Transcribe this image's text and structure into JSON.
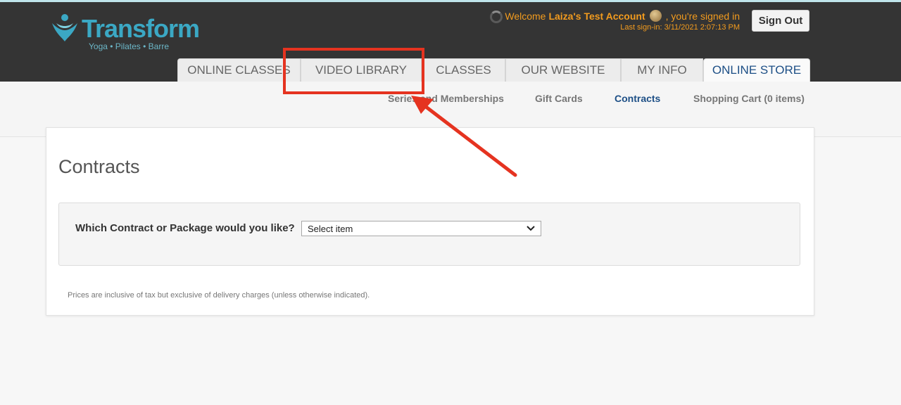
{
  "header": {
    "logo_text": "Transform",
    "logo_tagline": "Yoga • Pilates • Barre",
    "welcome_prefix": "Welcome",
    "account_name": "Laiza's Test Account",
    "welcome_suffix": ", you're signed in",
    "last_signin": "Last sign-in: 3/11/2021 2:07:13 PM",
    "signout_label": "Sign Out"
  },
  "tabs": [
    {
      "label": "ONLINE CLASSES",
      "active": false
    },
    {
      "label": "VIDEO LIBRARY",
      "active": false
    },
    {
      "label": "CLASSES",
      "active": false
    },
    {
      "label": "OUR WEBSITE",
      "active": false
    },
    {
      "label": "MY INFO",
      "active": false
    },
    {
      "label": "ONLINE STORE",
      "active": true
    }
  ],
  "subnav": [
    {
      "label": "Series and Memberships",
      "active": false
    },
    {
      "label": "Gift Cards",
      "active": false
    },
    {
      "label": "Contracts",
      "active": true
    },
    {
      "label": "Shopping Cart (0 items)",
      "active": false
    }
  ],
  "main": {
    "title": "Contracts",
    "question": "Which Contract or Package would you like?",
    "select_value": "Select item",
    "note": "Prices are inclusive of tax but exclusive of delivery charges (unless otherwise indicated)."
  },
  "colors": {
    "header_bg": "#343434",
    "accent_orange": "#f29b1e",
    "brand_teal": "#3ba8c4",
    "active_blue": "#1d4f86",
    "annotation_red": "#e53320"
  }
}
